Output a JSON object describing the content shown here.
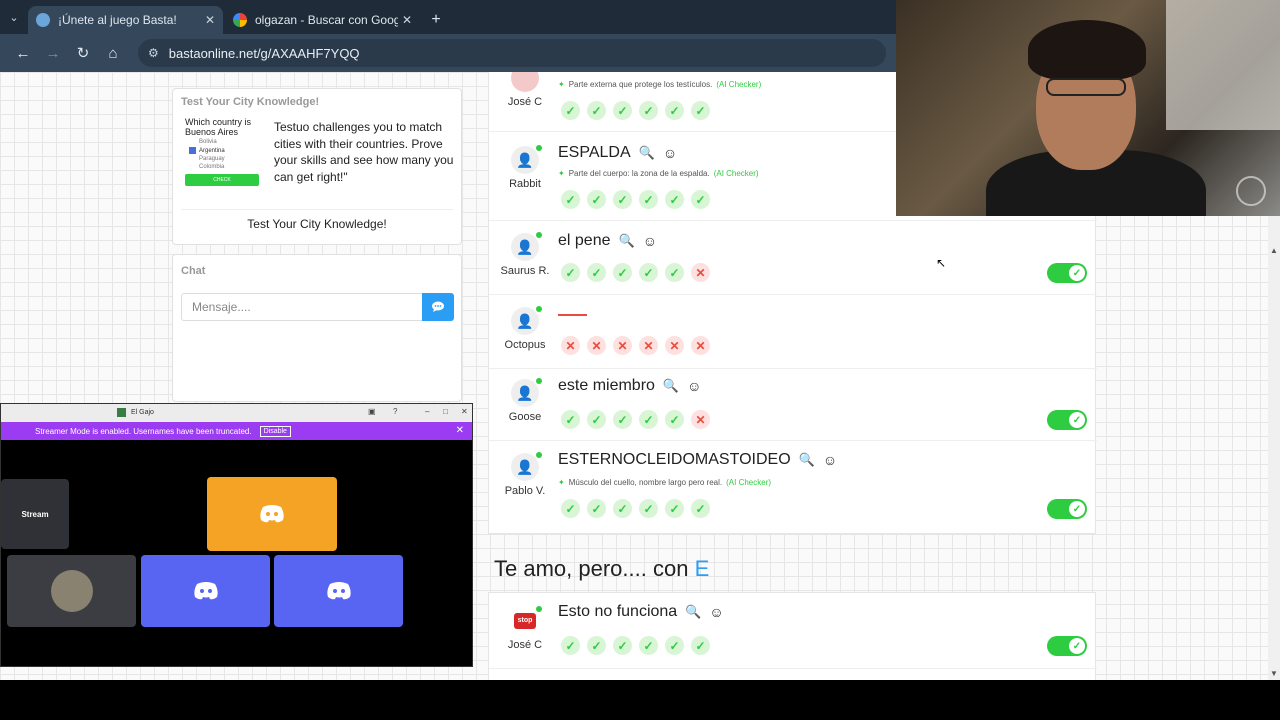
{
  "browser": {
    "tabs": [
      {
        "title": "¡Únete al juego Basta!",
        "active": true
      },
      {
        "title": "olgazan - Buscar con Google",
        "active": false
      }
    ],
    "url": "bastaonline.net/g/AXAAHF7YQQ"
  },
  "ad": {
    "title": "Test Your City Knowledge!",
    "quiz_question": "Which country is Buenos Aires",
    "quiz_options": [
      "Bolivia",
      "Argentina",
      "Paraguay",
      "Colombia"
    ],
    "quiz_check": "CHECK",
    "body": "Testuo challenges you to match cities with their countries. Prove your skills and see how many you can get right!\"",
    "cta": "Test Your City Knowledge!"
  },
  "chat": {
    "title": "Chat",
    "placeholder": "Mensaje...."
  },
  "rows": [
    {
      "user": "José C",
      "word": "",
      "hint": "Parte externa que protege los testículos.",
      "checker": "(AI Checker)",
      "votes": [
        "yes",
        "yes",
        "yes",
        "yes",
        "yes",
        "yes"
      ],
      "toggle": false
    },
    {
      "user": "Rabbit",
      "word": "ESPALDA",
      "hint": "Parte del cuerpo: la zona de la espalda.",
      "checker": "(AI Checker)",
      "votes": [
        "yes",
        "yes",
        "yes",
        "yes",
        "yes",
        "yes"
      ],
      "toggle": false
    },
    {
      "user": "Saurus R.",
      "word": "el pene",
      "hint": "",
      "checker": "",
      "votes": [
        "yes",
        "yes",
        "yes",
        "yes",
        "yes",
        "no"
      ],
      "toggle": true
    },
    {
      "user": "Octopus",
      "word": "",
      "hint": "",
      "checker": "",
      "votes": [
        "no",
        "no",
        "no",
        "no",
        "no",
        "no"
      ],
      "toggle": false
    },
    {
      "user": "Goose",
      "word": "este miembro",
      "hint": "",
      "checker": "",
      "votes": [
        "yes",
        "yes",
        "yes",
        "yes",
        "yes",
        "no"
      ],
      "toggle": true
    },
    {
      "user": "Pablo V.",
      "word": "ESTERNOCLEIDOMASTOIDEO",
      "hint": "Músculo del cuello, nombre largo pero real.",
      "checker": "(AI Checker)",
      "votes": [
        "yes",
        "yes",
        "yes",
        "yes",
        "yes",
        "yes"
      ],
      "toggle": true
    }
  ],
  "section": {
    "title": "Te amo, pero.... con",
    "letter": "E"
  },
  "rows2": [
    {
      "user": "José C",
      "word": "Esto no funciona",
      "votes": [
        "yes",
        "yes",
        "yes",
        "yes",
        "yes",
        "yes"
      ],
      "toggle": true
    }
  ],
  "discord": {
    "server": "El Gajo",
    "streamer_notice": "Streamer Mode is enabled. Usernames have been truncated.",
    "disable": "Disable",
    "stream_label": "Stream"
  },
  "colors": {
    "accent": "#2a9df4",
    "success": "#2ecc40",
    "danger": "#e74c3c",
    "discord": "#5865f2"
  }
}
